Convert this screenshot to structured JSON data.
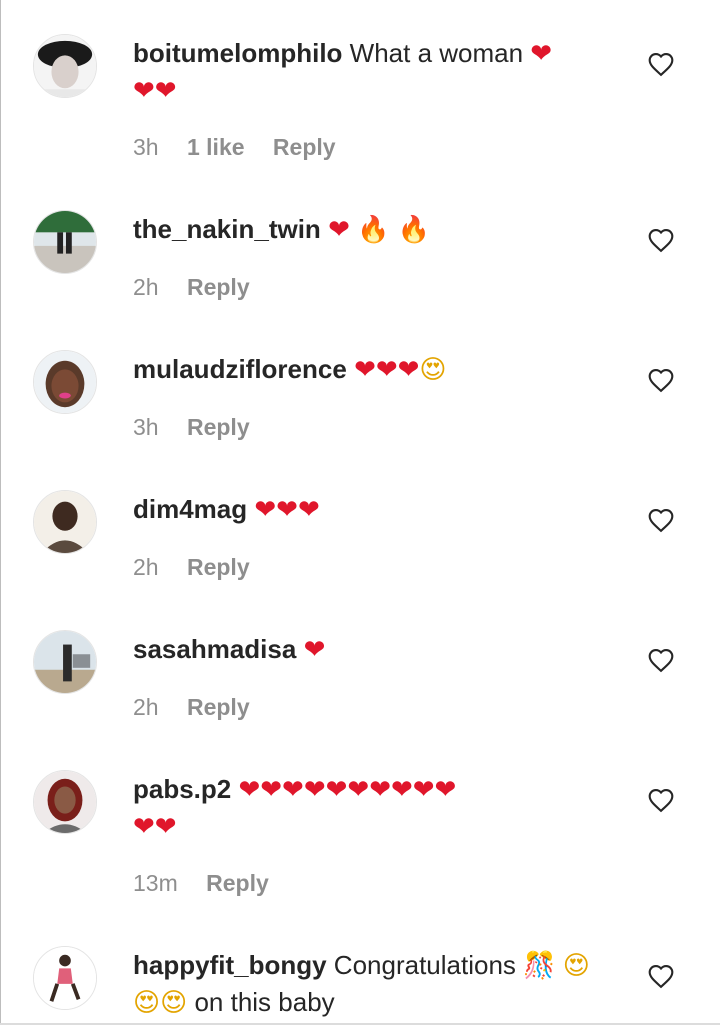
{
  "comments": [
    {
      "username": "boitumelomphilo",
      "text": "What a woman",
      "emoji": "❤",
      "emoji2": "❤❤",
      "time": "3h",
      "likes": "1 like",
      "reply": "Reply"
    },
    {
      "username": "the_nakin_twin",
      "text": "",
      "emoji": "❤",
      "emoji_fire": "🔥 🔥",
      "time": "2h",
      "reply": "Reply"
    },
    {
      "username": "mulaudziflorence",
      "text": "",
      "emoji": "❤❤❤",
      "emoji_smile": "😍",
      "time": "3h",
      "reply": "Reply"
    },
    {
      "username": "dim4mag",
      "text": "",
      "emoji": "❤❤❤",
      "time": "2h",
      "reply": "Reply"
    },
    {
      "username": "sasahmadisa",
      "text": "",
      "emoji": "❤",
      "time": "2h",
      "reply": "Reply"
    },
    {
      "username": "pabs.p2",
      "text": "",
      "emoji": "❤❤❤❤❤❤❤❤❤❤",
      "emoji2": "❤❤",
      "time": "13m",
      "reply": "Reply"
    },
    {
      "username": "happyfit_bongy",
      "text": "Congratulations",
      "emoji_party": "🎊",
      "emoji_smile": "😍",
      "emoji_smile2": "😍😍",
      "text2": "on this baby"
    }
  ],
  "icons": {
    "like": "heart-outline-icon"
  },
  "colors": {
    "heart": "#e0162b",
    "meta": "#8e8e8e",
    "text": "#262626"
  }
}
